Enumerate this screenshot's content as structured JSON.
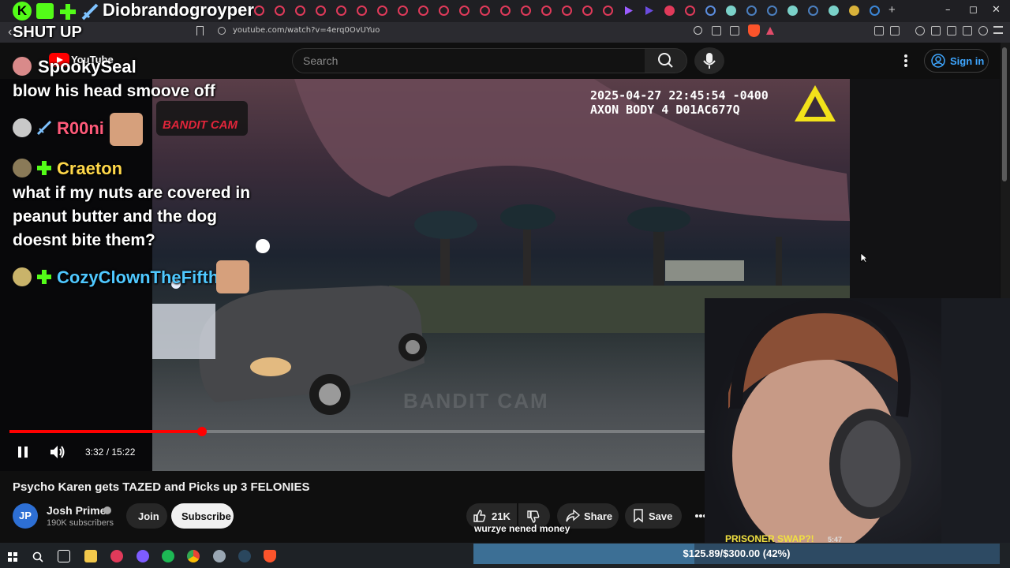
{
  "browser": {
    "tab_title": "Diobrandogroyper",
    "url": "youtube.com/watch?v=4erq0OvUYuo",
    "window_controls": [
      "–",
      "◻",
      "✕"
    ],
    "new_tab": "+"
  },
  "overlay": {
    "shut_up_text": "SHUT UP",
    "youtube_logo_text": "YouTube"
  },
  "youtube": {
    "search_placeholder": "Search",
    "sign_in_label": "Sign in"
  },
  "chat": [
    {
      "user": "SpookySeal",
      "user_color": "#ffffff",
      "message": "blow his head smoove off"
    },
    {
      "user": "R00ni",
      "user_color": "#ff5a7a",
      "message": ""
    },
    {
      "user": "Craeton",
      "user_color": "#ffd84a",
      "message": "what if my nuts are covered in peanut butter and the dog doesnt bite them?",
      "lines": [
        "what if my nuts are covered in",
        "peanut butter and the dog",
        "doesnt bite them?"
      ]
    },
    {
      "user": "CozyClownTheFifth",
      "user_color": "#4fc8ff",
      "message": ""
    }
  ],
  "bodycam": {
    "timestamp": "2025-04-27 22:45:54 -0400",
    "device": "AXON BODY 4 D01AC677Q",
    "watermark": "BANDIT CAM",
    "sticker_text": "BANDIT CAM"
  },
  "player": {
    "time_display": "3:32 / 15:22",
    "progress_fraction": 0.2299
  },
  "video": {
    "title": "Psycho Karen gets TAZED and Picks up 3 FELONIES",
    "channel_name": "Josh Prime",
    "channel_initials": "JP",
    "subscribers": "190K subscribers",
    "join_label": "Join",
    "subscribe_label": "Subscribe",
    "likes": "21K",
    "share_label": "Share",
    "save_label": "Save"
  },
  "stream": {
    "donation_text": "wurzye nened money",
    "prisoner_text": "PRISONER SWAP?!",
    "prisoner_time": "5:47",
    "goal_text": "$125.89/$300.00 (42%)",
    "goal_fraction": 0.42
  },
  "colors": {
    "accent_red": "#ff0000",
    "link_blue": "#3ea6ff",
    "goal_fill": "#3c6f95"
  }
}
